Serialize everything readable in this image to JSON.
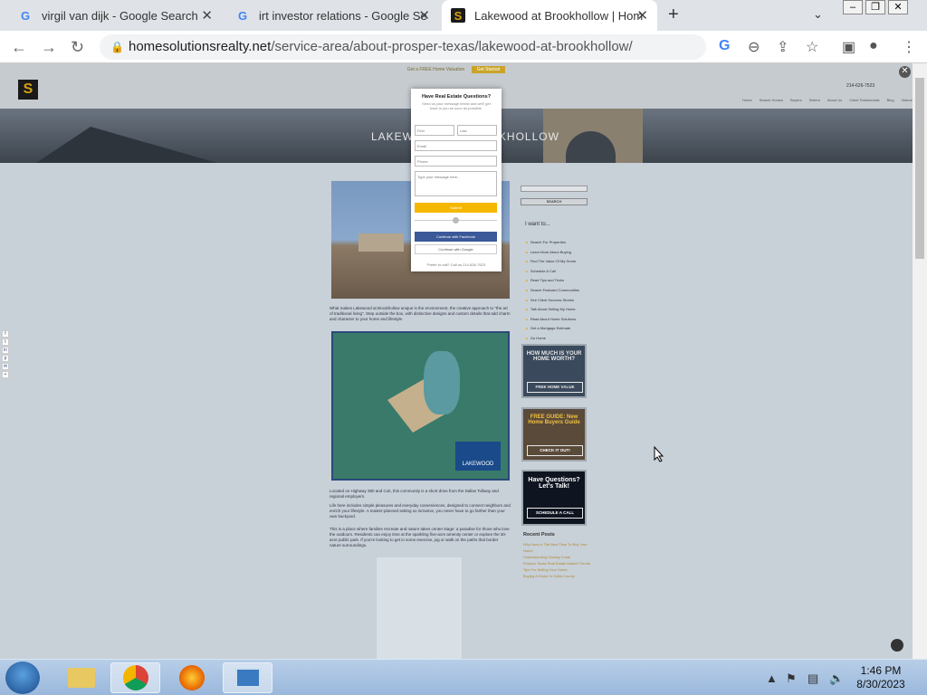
{
  "browser": {
    "tabs": [
      {
        "title": "virgil van dijk - Google Search",
        "icon": "google-icon"
      },
      {
        "title": "irt investor relations - Google Se",
        "icon": "google-icon"
      },
      {
        "title": "Lakewood at Brookhollow | Hom",
        "icon": "site-logo-icon"
      }
    ],
    "new_tab": "+",
    "url_domain": "homesolutionsrealty.net",
    "url_path": "/service-area/about-prosper-texas/lakewood-at-brookhollow/"
  },
  "site": {
    "logo_letter": "S",
    "notice_text": "Get a FREE Home Valuation",
    "notice_button": "Get Started",
    "phone": "214-626-7523",
    "nav": [
      "Home",
      "Search Homes",
      "Buyers",
      "Sellers",
      "About Us",
      "Client Testimonials",
      "Blog",
      "Videos"
    ],
    "hero_title": "LAKEWOOD AT BROOKHOLLOW",
    "para1": "What makes Lakewood at Brookhollow unique is the environment, the creative approach to \"the art of traditional living\". Step outside the box, with distinctive designs and custom details that add charm and character to your home and lifestyle.",
    "map_brand": "LAKEWOOD",
    "para2": "Located on Highway 380 and Coit, this community is a short drive from the Dallas Tollway and regional employers.",
    "para3": "Life here includes simple pleasures and everyday conveniences, designed to connect neighbors and enrich your lifestyle. A master-planned setting so inclusive, you never have to go farther than your own backyard.",
    "para4": "This is a place where families recreate and nature takes center stage: a paradise for those who love the outdoors. Residents can enjoy time at the sparkling five-acre amenity center or explore the 30-acre public park. If you're looking to get in some exercise, jog or walk on the paths that border nature surroundings.",
    "sidebar": {
      "search_button": "SEARCH",
      "heading": "I want to...",
      "items": [
        "Search For Properties",
        "Learn More About Buying",
        "Find The Value Of My Home",
        "Schedule A Call",
        "Read Tips and Tricks",
        "Search Featured Communities",
        "See Client Success Stories",
        "Talk About Selling My Home",
        "Read About Home Solutions",
        "Get a Mortgage Estimate",
        "Go Home"
      ],
      "promo1_title": "HOW MUCH IS YOUR HOME WORTH?",
      "promo1_button": "FREE HOME VALUE",
      "promo2_title": "FREE GUIDE: New Home Buyers Guide",
      "promo2_button": "CHECK IT OUT!",
      "promo3_title": "Have Questions? Let's Talk!",
      "promo3_button": "SCHEDULE A CALL",
      "recent_heading": "Recent Posts",
      "recent": [
        "Why Now Is The Best Time To Buy Your Home",
        "Understanding Closing Costs",
        "Prosper Texas Real Estate Market Trends",
        "Tips For Selling Your Home",
        "Buying A Home In Collin County"
      ]
    },
    "modal": {
      "title": "Have Real Estate Questions?",
      "subtitle": "Send us your message below and we'll get back to you as soon as possible.",
      "first_placeholder": "First",
      "last_placeholder": "Last",
      "email_placeholder": "Email",
      "phone_placeholder": "Phone",
      "message_placeholder": "Type your message here...",
      "submit": "Submit",
      "facebook": "Continue with Facebook",
      "google": "Continue with Google",
      "call_us": "Prefer to call? Call us 214-626-7523"
    }
  },
  "taskbar": {
    "time": "1:46 PM",
    "date": "8/30/2023"
  },
  "colors": {
    "accent": "#c9a42a",
    "facebook": "#3b5998",
    "submit": "#f5b800"
  }
}
